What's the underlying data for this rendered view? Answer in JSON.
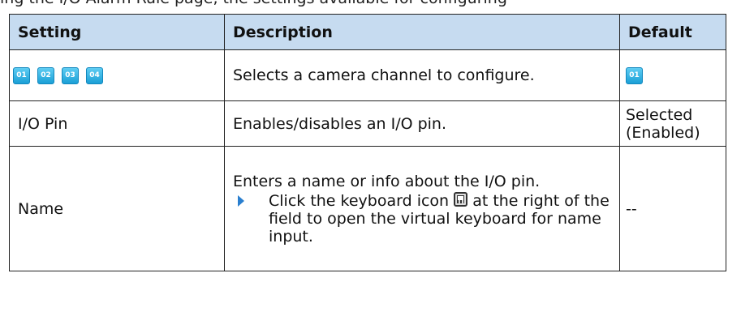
{
  "cut_text": "ing the I/O Alarm Rule page, the settings available for configuring",
  "table": {
    "headers": [
      "Setting",
      "Description",
      "Default"
    ],
    "rows": [
      {
        "setting_chips": [
          "01",
          "02",
          "03",
          "04"
        ],
        "description": "Selects a camera channel to configure.",
        "default_chip": "01"
      },
      {
        "setting": "I/O Pin",
        "description": "Enables/disables an I/O pin.",
        "default": "Selected (Enabled)"
      },
      {
        "setting": "Name",
        "description": "Enters a name or info about the I/O pin.",
        "bullet_before": "Click the keyboard icon",
        "bullet_icon": "keyboard-icon",
        "bullet_after": "at the right of the field to open the virtual keyboard for name input.",
        "default": "--"
      }
    ]
  }
}
